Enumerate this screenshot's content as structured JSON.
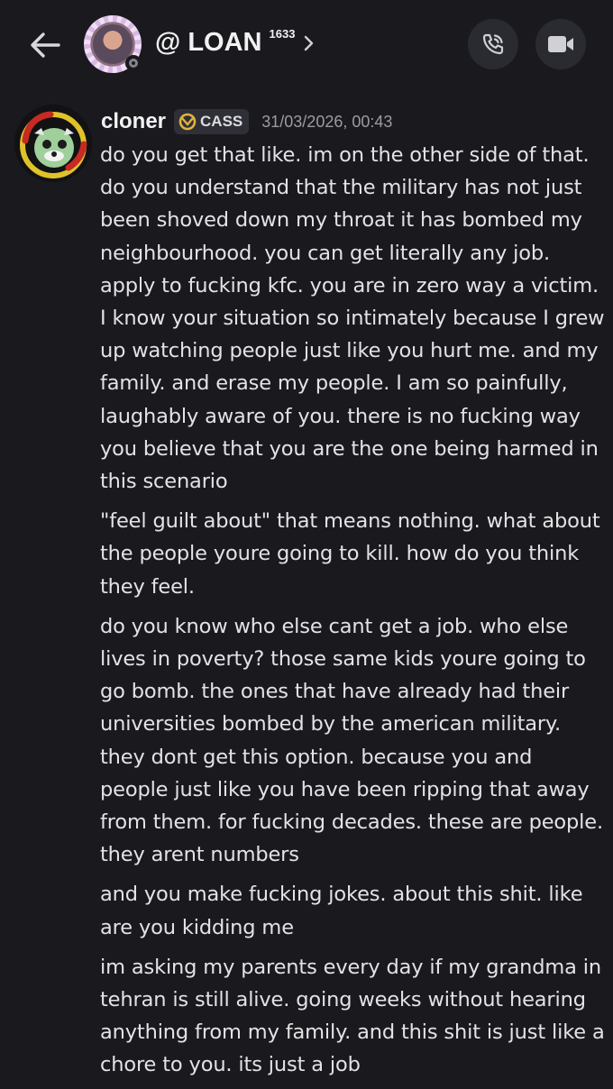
{
  "header": {
    "title": "@ LOAN",
    "count": "1633"
  },
  "icons": {
    "back": "arrow-left-icon",
    "chevron": "chevron-right-icon",
    "call": "phone-call-icon",
    "video": "video-camera-icon",
    "status": "idle-status-icon",
    "tag": "guild-tag-icon"
  },
  "colors": {
    "background": "#1a1a1e",
    "button_bg": "#2a2b30",
    "tag_bg": "#2f3037",
    "tag_icon": "#e2b33b",
    "timestamp": "#9a9ba3"
  },
  "message": {
    "username": "cloner",
    "tag": "CASS",
    "timestamp": "31/03/2026, 00:43",
    "paragraphs": [
      "do you get that like. im on the other side of that. do you understand that the military has not just been shoved down my throat it has bombed my neighbourhood. you can get literally any job. apply to fucking kfc. you are in zero way a victim. I know your situation so intimately because I grew up watching people just like you hurt me. and my family. and erase my people. I am so painfully, laughably aware of you. there is no fucking way you believe that you are the one being harmed in this scenario",
      "\"feel guilt about\" that means nothing. what about the people youre going to kill. how do you think they feel.",
      "do you know who else cant get a job. who else lives in poverty? those same kids youre going to go bomb. the ones that have already had their universities bombed by the american military. they dont get this option. because you and people just like you have been ripping that away from them. for fucking decades. these are people. they arent numbers",
      "and you make fucking jokes. about this shit. like are you kidding me",
      "im asking my parents every day if my grandma in tehran is still alive. going weeks without hearing anything from my family. and this shit is just like a chore to you. its just a job"
    ]
  }
}
